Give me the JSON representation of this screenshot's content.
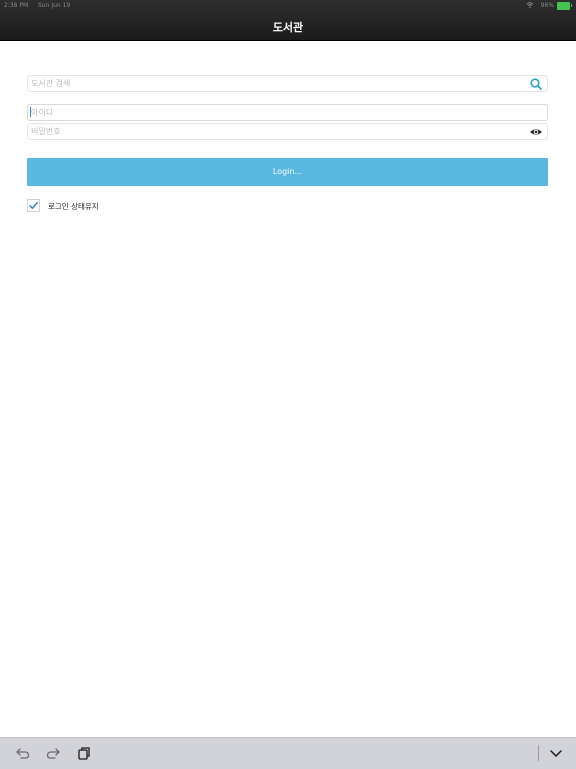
{
  "status_bar": {
    "time": "2:38 PM",
    "date": "Sun Jun 19",
    "battery": "96%",
    "battery_color": "#44c24f"
  },
  "header": {
    "title": "도서관"
  },
  "search": {
    "placeholder": "도서관 검색",
    "icon": "search-icon"
  },
  "login_form": {
    "id_placeholder": "아이디",
    "password_placeholder": "비밀번호",
    "show_password_icon": "eye-icon",
    "login_button": "Login...",
    "remember_label": "로그인 상태유지",
    "remember_checked": true
  },
  "colors": {
    "accent": "#5ab7e0",
    "search_icon": "#2aa6c9"
  },
  "toolbar": {
    "icons": [
      "undo-icon",
      "redo-icon",
      "clipboard-icon",
      "chevron-down-icon"
    ]
  }
}
